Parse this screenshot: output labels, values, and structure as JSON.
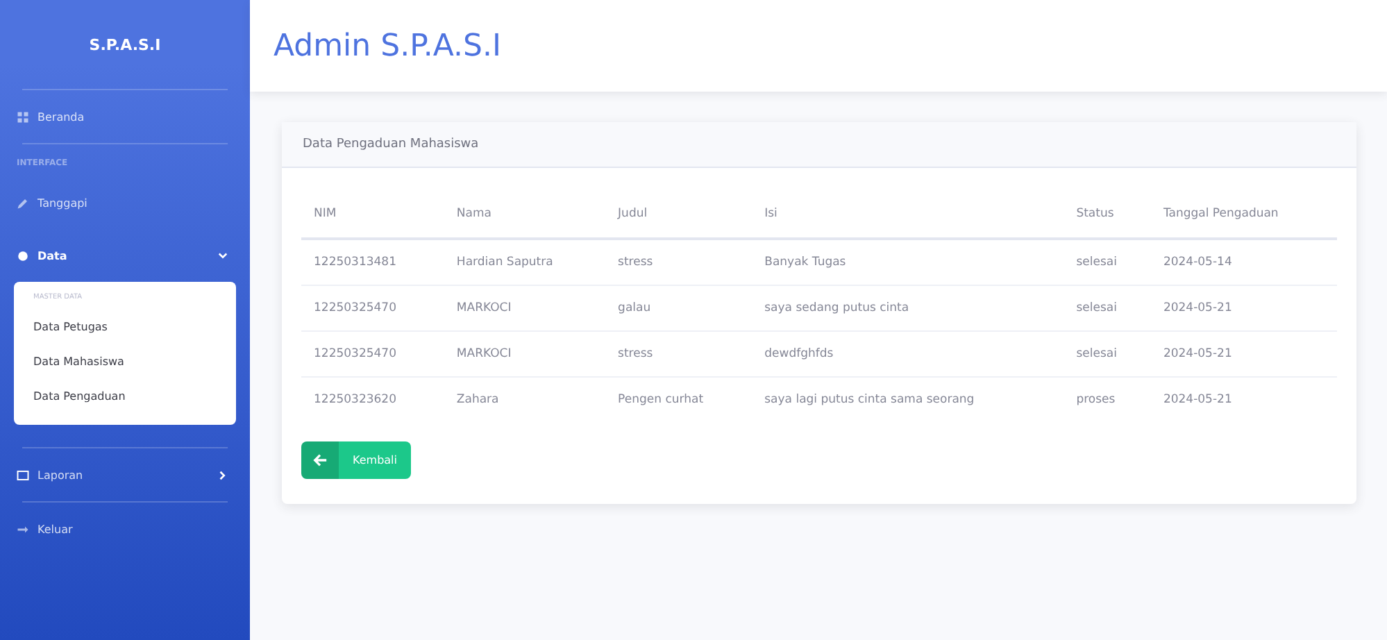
{
  "sidebar": {
    "brand": "S.P.A.S.I",
    "items": [
      {
        "kind": "link",
        "label": "Beranda"
      },
      {
        "kind": "heading",
        "label": "INTERFACE"
      },
      {
        "kind": "link",
        "label": "Tanggapi"
      },
      {
        "kind": "menu",
        "label": "Data",
        "expanded": true,
        "submenu": {
          "heading": "MASTER DATA",
          "items": [
            "Data Petugas",
            "Data Mahasiswa",
            "Data Pengaduan"
          ]
        }
      },
      {
        "kind": "menu",
        "label": "Laporan",
        "expanded": false
      },
      {
        "kind": "link",
        "label": "Keluar"
      }
    ]
  },
  "topbar": {
    "title": "Admin S.P.A.S.I"
  },
  "card": {
    "title": "Data Pengaduan Mahasiswa",
    "table": {
      "columns": [
        "NIM",
        "Nama",
        "Judul",
        "Isi",
        "Status",
        "Tanggal Pengaduan"
      ],
      "rows": [
        [
          "12250313481",
          "Hardian Saputra",
          "stress",
          "Banyak Tugas",
          "selesai",
          "2024-05-14"
        ],
        [
          "12250325470",
          "MARKOCI",
          "galau",
          "saya sedang putus cinta",
          "selesai",
          "2024-05-21"
        ],
        [
          "12250325470",
          "MARKOCI",
          "stress",
          "dewdfghfds",
          "selesai",
          "2024-05-21"
        ],
        [
          "12250323620",
          "Zahara",
          "Pengen curhat",
          "saya lagi putus cinta sama seorang",
          "proses",
          "2024-05-21"
        ]
      ]
    },
    "button": "Kembali"
  }
}
